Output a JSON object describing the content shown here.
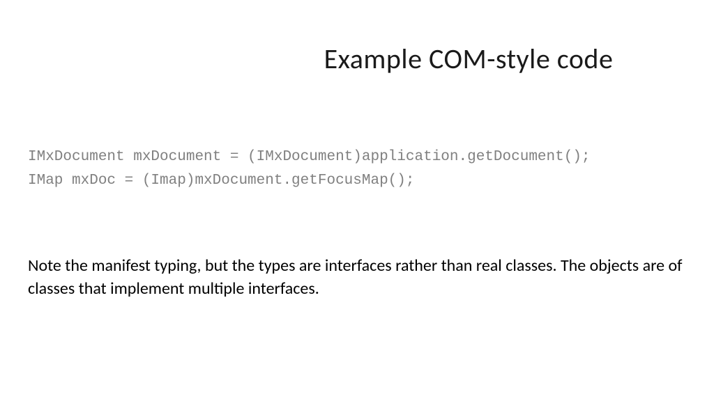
{
  "slide": {
    "title": "Example COM-style code",
    "code": {
      "line1": "IMxDocument mxDocument = (IMxDocument)application.getDocument();",
      "line2": "IMap mxDoc = (Imap)mxDocument.getFocusMap();"
    },
    "note": "Note the manifest typing, but the types are interfaces rather than real classes. The objects are of classes that implement multiple interfaces."
  }
}
